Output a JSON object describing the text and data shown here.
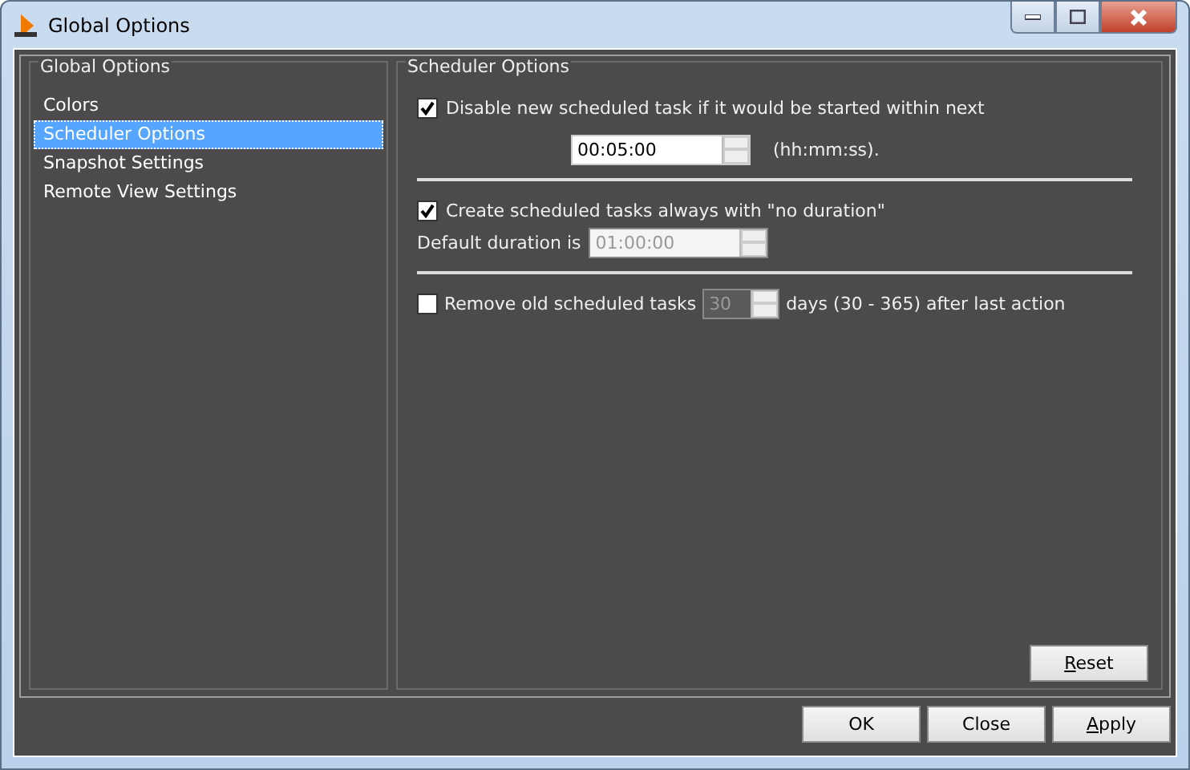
{
  "window": {
    "title": "Global Options"
  },
  "sidebar": {
    "title": "Global Options",
    "items": [
      {
        "label": "Colors",
        "selected": false
      },
      {
        "label": "Scheduler Options",
        "selected": true
      },
      {
        "label": "Snapshot Settings",
        "selected": false
      },
      {
        "label": "Remote View Settings",
        "selected": false
      }
    ]
  },
  "panel": {
    "title": "Scheduler Options",
    "disable_task": {
      "label": "Disable new scheduled task if it would be started within next",
      "checked": true,
      "spin": {
        "value": "00:05:00",
        "disabled": false
      },
      "suffix": "(hh:mm:ss)."
    },
    "no_duration": {
      "label": "Create scheduled tasks always with \"no duration\"",
      "checked": true,
      "prefix": "Default duration is",
      "spin": {
        "value": "01:00:00",
        "disabled": true
      }
    },
    "remove_old": {
      "label": "Remove old scheduled tasks",
      "checked": false,
      "spin": {
        "value": "30",
        "disabled": true
      },
      "suffix": "days (30 - 365) after last action"
    },
    "reset": {
      "label": "Reset",
      "mnemonic": true
    }
  },
  "buttons": [
    {
      "label": "OK",
      "mnemonic": false
    },
    {
      "label": "Close",
      "mnemonic": false
    },
    {
      "label": "Apply",
      "mnemonic": true
    }
  ]
}
